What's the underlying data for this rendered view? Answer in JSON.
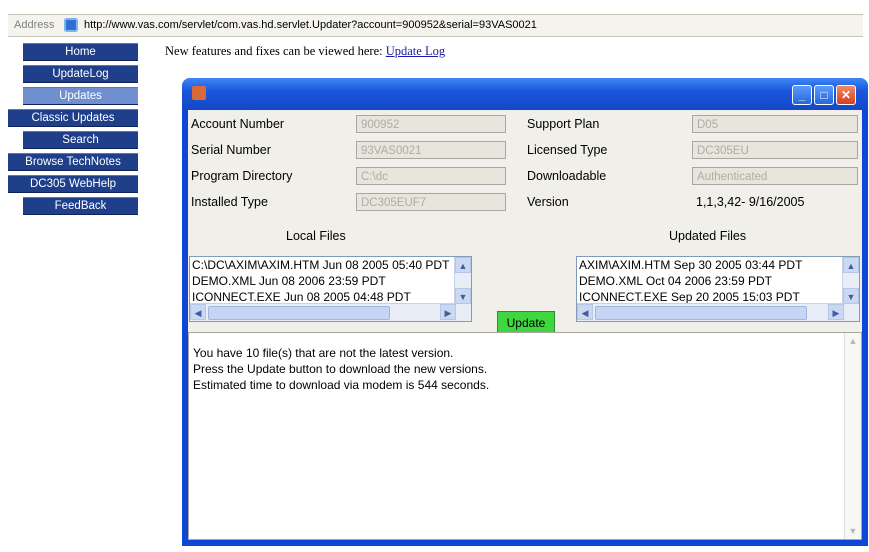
{
  "address_bar": {
    "label": "Address",
    "url": "http://www.vas.com/servlet/com.vas.hd.servlet.Updater?account=900952&serial=93VAS0021"
  },
  "nav": {
    "items": [
      {
        "label": "Home"
      },
      {
        "label": "UpdateLog"
      },
      {
        "label": "Updates"
      },
      {
        "label": "Classic Updates"
      },
      {
        "label": "Search"
      },
      {
        "label": "Browse TechNotes"
      },
      {
        "label": "DC305 WebHelp"
      },
      {
        "label": "FeedBack"
      }
    ]
  },
  "top_note": {
    "text": "New features and fixes can be viewed here:",
    "link": "Update Log"
  },
  "window": {
    "buttons": {
      "min": "_",
      "max": "□",
      "close": "✕"
    },
    "fields": {
      "account_number": {
        "label": "Account Number",
        "value": "900952"
      },
      "serial_number": {
        "label": "Serial Number",
        "value": "93VAS0021"
      },
      "program_directory": {
        "label": "Program Directory",
        "value": "C:\\dc"
      },
      "installed_type": {
        "label": "Installed Type",
        "value": "DC305EUF7"
      },
      "support_plan": {
        "label": "Support Plan",
        "value": "D05"
      },
      "licensed_type": {
        "label": "Licensed Type",
        "value": "DC305EU"
      },
      "downloadable": {
        "label": "Downloadable",
        "value": "Authenticated"
      },
      "version": {
        "label": "Version",
        "value": "1,1,3,42- 9/16/2005"
      }
    },
    "local_files": {
      "title": "Local Files",
      "items": [
        "C:\\DC\\AXIM\\AXIM.HTM Jun 08 2005 05:40 PDT",
        "DEMO.XML Jun 08 2006 23:59 PDT",
        "ICONNECT.EXE Jun 08 2005 04:48 PDT"
      ]
    },
    "updated_files": {
      "title": "Updated Files",
      "items": [
        "AXIM\\AXIM.HTM Sep 30 2005 03:44 PDT",
        "DEMO.XML Oct 04 2006 23:59 PDT",
        "ICONNECT.EXE Sep 20 2005 15:03 PDT"
      ]
    },
    "update_button": "Update",
    "message_lines": [
      "You have 10 file(s) that are not the latest version.",
      "Press the Update button to download the new versions.",
      "Estimated time to download via modem is 544 seconds."
    ]
  }
}
